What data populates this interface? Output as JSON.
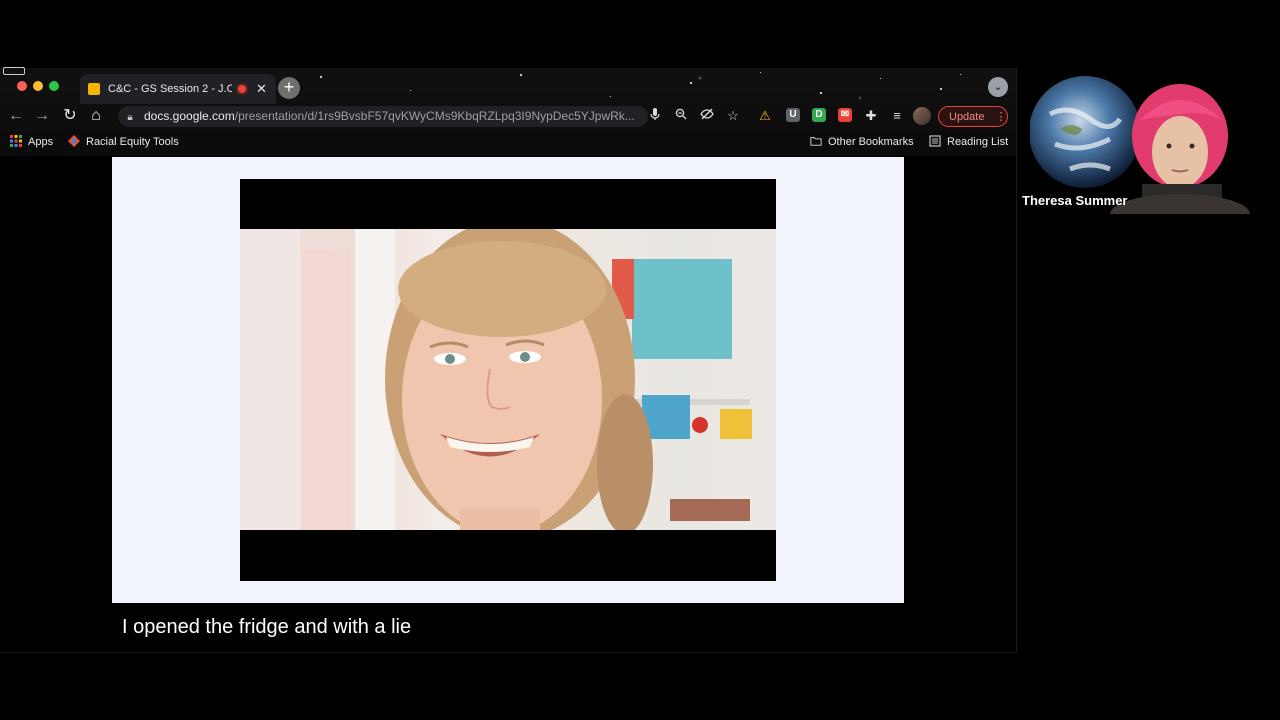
{
  "browser": {
    "tab": {
      "title": "C&C - GS Session 2 - J.C"
    },
    "address": {
      "host": "docs.google.com",
      "path": "/presentation/d/1rs9BvsbF57qvKWyCMs9KbqRZLpq3I9NypDec5YJpwRk..."
    },
    "extensions": [
      "U",
      "D"
    ],
    "update_label": "Update",
    "bookmarks": {
      "apps": "Apps",
      "racial_equity": "Racial Equity Tools",
      "other": "Other Bookmarks",
      "reading_list": "Reading List"
    }
  },
  "caption": {
    "text": "I opened the fridge and with a lie"
  },
  "participant": {
    "name": "Theresa Summer"
  },
  "icons": [
    "back-icon",
    "forward-icon",
    "reload-icon",
    "home-icon",
    "lock-icon",
    "mic-icon",
    "zoom-icon",
    "eye-off-icon",
    "star-icon",
    "warning-icon",
    "puzzle-icon",
    "playlist-icon",
    "apps-grid-icon",
    "folder-icon",
    "reading-list-icon",
    "profile-icon"
  ],
  "colors": {
    "update_accent": "#e8453c",
    "slide_bg": "#f1f5fb",
    "tab_favicon": "#f4b400"
  }
}
